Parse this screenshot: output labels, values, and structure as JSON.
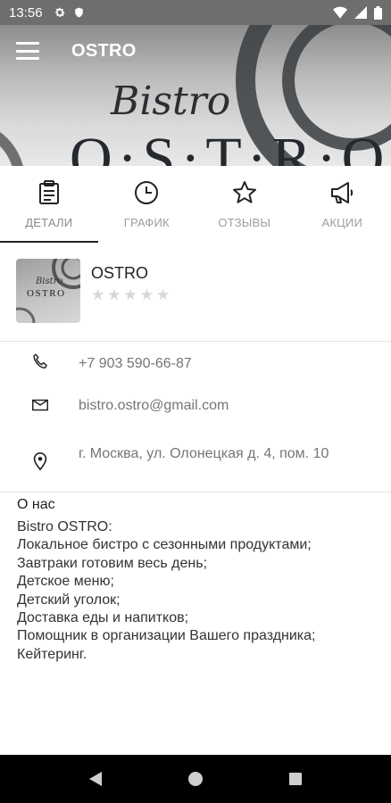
{
  "status_bar": {
    "time": "13:56"
  },
  "app_bar": {
    "title": "OSTRO"
  },
  "hero": {
    "brand_script": "Bistro",
    "brand_main": "O·S·T·R·O"
  },
  "tabs": [
    {
      "label": "ДЕТАЛИ",
      "icon": "clipboard-icon",
      "active": true
    },
    {
      "label": "ГРАФИК",
      "icon": "clock-icon",
      "active": false
    },
    {
      "label": "ОТЗЫВЫ",
      "icon": "star-icon",
      "active": false
    },
    {
      "label": "АКЦИИ",
      "icon": "megaphone-icon",
      "active": false
    }
  ],
  "profile": {
    "name": "OSTRO",
    "logo_script": "Bistro",
    "logo_main": "OSTRO",
    "rating": 0,
    "rating_max": 5
  },
  "contacts": {
    "phone": "+7 903 590-66-87",
    "email": "bistro.ostro@gmail.com",
    "address": "г. Москва, ул. Олонецкая д. 4, пом. 10"
  },
  "about": {
    "title": "О нас",
    "lines": [
      "Bistro OSTRO:",
      "Локальное бистро с сезонными продуктами;",
      "Завтраки готовим весь день;",
      "Детское меню;",
      "Детский уголок;",
      "Доставка еды и напитков;",
      "Помощник в организации Вашего праздника;",
      "Кейтеринг."
    ]
  },
  "colors": {
    "accent": "#222222",
    "muted_text": "#757575",
    "star_empty": "#d6d6d6",
    "status_bar_bg": "#6e6e6e"
  }
}
